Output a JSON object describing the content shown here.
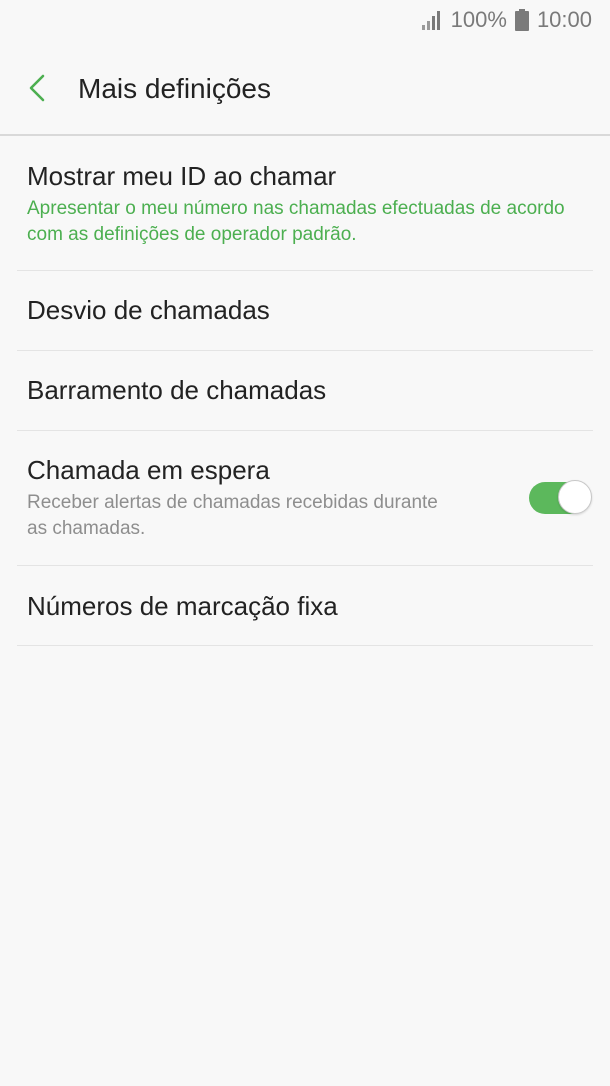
{
  "status_bar": {
    "battery": "100%",
    "time": "10:00",
    "signal_icon": "signal-icon",
    "battery_icon": "battery-icon"
  },
  "header": {
    "title": "Mais definições",
    "back_icon": "chevron-left-icon"
  },
  "settings": {
    "caller_id": {
      "title": "Mostrar meu ID ao chamar",
      "subtitle": "Apresentar o meu número nas chamadas efectuadas de acordo com as definições de operador padrão."
    },
    "call_forwarding": {
      "title": "Desvio de chamadas"
    },
    "call_barring": {
      "title": "Barramento de chamadas"
    },
    "call_waiting": {
      "title": "Chamada em espera",
      "subtitle": "Receber alertas de chamadas recebidas durante as chamadas.",
      "toggle_on": true
    },
    "fixed_dialing": {
      "title": "Números de marcação fixa"
    }
  },
  "colors": {
    "accent": "#4caf50",
    "toggle_on": "#5cb85c",
    "background": "#f8f8f8",
    "divider": "#e4e4e4"
  }
}
